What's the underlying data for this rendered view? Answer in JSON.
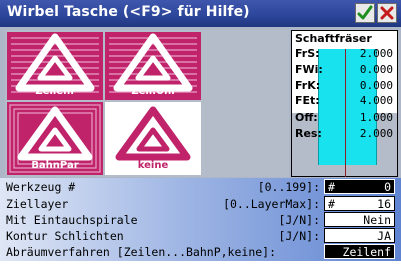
{
  "window": {
    "title": "Wirbel Tasche (<F9> für Hilfe)",
    "ok_icon": "checkmark-icon",
    "close_icon": "close-icon",
    "accent": "#2d479c"
  },
  "preview": {
    "strategies": [
      {
        "label": "Zeilenf",
        "fill": "#c0236a",
        "label_color": "#ffffff"
      },
      {
        "label": "Zeil.Uni",
        "fill": "#c0236a",
        "label_color": "#ffffff"
      },
      {
        "label": "BahnPar",
        "fill": "#c0236a",
        "label_color": "#ffffff"
      },
      {
        "label": "keine",
        "fill": "#ffffff",
        "label_color": "#c0236a"
      }
    ]
  },
  "tool_params": {
    "header": "Schaftfräser",
    "rows": [
      {
        "label": "FrS:",
        "value": "2.000"
      },
      {
        "label": "FWi:",
        "value": "0.000"
      },
      {
        "label": "FrK:",
        "value": "0.000"
      },
      {
        "label": "FEt:",
        "value": "4.000"
      },
      {
        "label": "Off:",
        "value": "1.000"
      },
      {
        "label": "Res:",
        "value": "2.000"
      }
    ],
    "tool_color": "#17e2ee"
  },
  "form": {
    "fields": [
      {
        "label": "Werkzeug #",
        "range": "[0..199]:",
        "prefix": "#",
        "value": "0",
        "style": "black"
      },
      {
        "label": "Ziellayer",
        "range": "[0..LayerMax]:",
        "prefix": "#",
        "value": "16",
        "style": "white"
      },
      {
        "label": "Mit Eintauchspirale",
        "range": "[J/N]:",
        "prefix": "",
        "value": "Nein",
        "style": "white"
      },
      {
        "label": "Kontur Schlichten",
        "range": "[J/N]:",
        "prefix": "",
        "value": "JA",
        "style": "white"
      },
      {
        "label": "Abräumverfahren [Zeilen...BahnP,keine]:",
        "range": "",
        "prefix": "",
        "value": "Zeilenf",
        "style": "black"
      }
    ]
  }
}
